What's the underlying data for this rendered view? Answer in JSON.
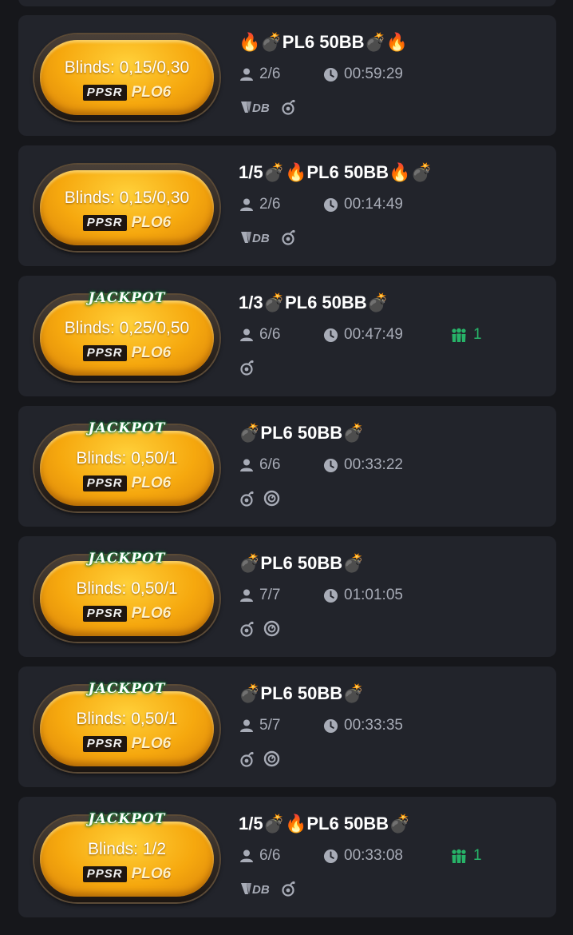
{
  "tables": [
    {
      "jackpot": false,
      "blinds": "Blinds:  0,15/0,30",
      "brand": "PPSR",
      "variant": "PLO6",
      "title": "🔥💣PL6 50BB💣🔥",
      "players": "2/6",
      "time": "00:59:29",
      "waiting": null,
      "badges": [
        "double-board-icon",
        "bomb-pot-icon"
      ]
    },
    {
      "jackpot": false,
      "blinds": "Blinds:  0,15/0,30",
      "brand": "PPSR",
      "variant": "PLO6",
      "title": "1/5💣🔥PL6 50BB🔥💣",
      "players": "2/6",
      "time": "00:14:49",
      "waiting": null,
      "badges": [
        "double-board-icon",
        "bomb-pot-icon"
      ]
    },
    {
      "jackpot": true,
      "jackpot_label": "JACKPOT",
      "blinds": "Blinds:  0,25/0,50",
      "brand": "PPSR",
      "variant": "PLO6",
      "title": "1/3💣PL6 50BB💣",
      "players": "6/6",
      "time": "00:47:49",
      "waiting": "1",
      "badges": [
        "bomb-pot-icon"
      ]
    },
    {
      "jackpot": true,
      "jackpot_label": "JACKPOT",
      "blinds": "Blinds:  0,50/1",
      "brand": "PPSR",
      "variant": "PLO6",
      "title": "💣PL6 50BB💣",
      "players": "6/6",
      "time": "00:33:22",
      "waiting": null,
      "badges": [
        "bomb-pot-icon",
        "timer-icon"
      ]
    },
    {
      "jackpot": true,
      "jackpot_label": "JACKPOT",
      "blinds": "Blinds:  0,50/1",
      "brand": "PPSR",
      "variant": "PLO6",
      "title": "💣PL6 50BB💣",
      "players": "7/7",
      "time": "01:01:05",
      "waiting": null,
      "badges": [
        "bomb-pot-icon",
        "timer-icon"
      ]
    },
    {
      "jackpot": true,
      "jackpot_label": "JACKPOT",
      "blinds": "Blinds:  0,50/1",
      "brand": "PPSR",
      "variant": "PLO6",
      "title": "💣PL6 50BB💣",
      "players": "5/7",
      "time": "00:33:35",
      "waiting": null,
      "badges": [
        "bomb-pot-icon",
        "timer-icon"
      ]
    },
    {
      "jackpot": true,
      "jackpot_label": "JACKPOT",
      "blinds": "Blinds:  1/2",
      "brand": "PPSR",
      "variant": "PLO6",
      "title": "1/5💣🔥PL6 50BB💣",
      "players": "6/6",
      "time": "00:33:08",
      "waiting": "1",
      "badges": [
        "double-board-icon",
        "bomb-pot-icon"
      ]
    }
  ],
  "colors": {
    "background": "#16171b",
    "card": "#22242b",
    "felt": "#f6a80e",
    "muted_text": "#a8acb7",
    "waiting_green": "#27b368"
  }
}
